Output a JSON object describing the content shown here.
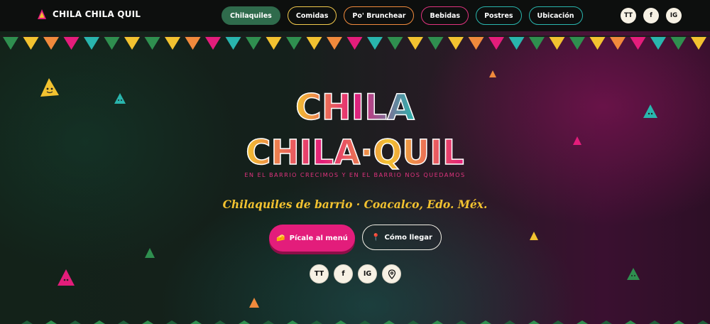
{
  "brand": {
    "name": "CHILA CHILA QUIL"
  },
  "nav": {
    "items": [
      {
        "label": "Chilaquiles",
        "color": "#2f6b4c",
        "active": true
      },
      {
        "label": "Comidas",
        "color": "#f2c94c"
      },
      {
        "label": "Po' Brunchear",
        "color": "#f08a3c"
      },
      {
        "label": "Bebidas",
        "color": "#e0337e"
      },
      {
        "label": "Postres",
        "color": "#29b5ad"
      },
      {
        "label": "Ubicación",
        "color": "#29b5ad"
      }
    ],
    "social": [
      "TT",
      "f",
      "IG"
    ]
  },
  "hero": {
    "logo_line1": "CHILA",
    "logo_line2": "CHILA·QUIL",
    "tagline": "EN EL BARRIO CRECIMOS Y EN EL BARRIO NOS QUEDAMOS",
    "subtitle": "Chilaquiles de barrio · Coacalco, Edo. Méx.",
    "cta_primary": {
      "icon": "🧀",
      "label": "Pícale al menú"
    },
    "cta_secondary": {
      "icon": "📍",
      "label": "Cómo llegar"
    },
    "social": [
      "TT",
      "f",
      "IG"
    ],
    "location_icon": "map-pin-icon"
  },
  "colors": {
    "yellow": "#f2c230",
    "magenta": "#e31d7b",
    "teal": "#29b5ad",
    "green": "#2f8f4f",
    "orange": "#f08a3c",
    "dark": "#0d0f0e"
  }
}
